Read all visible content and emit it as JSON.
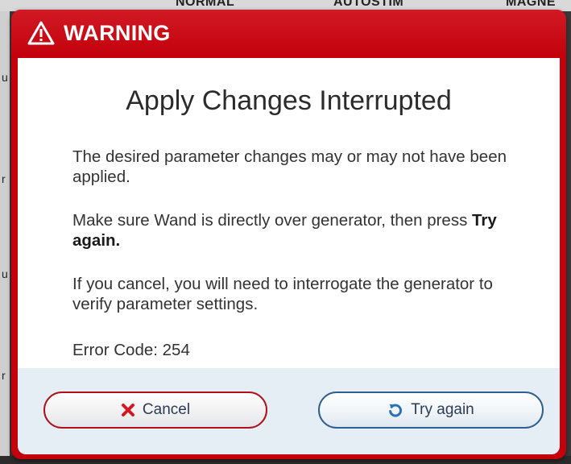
{
  "background": {
    "header_labels": [
      "NORMAL",
      "AUTOSTIM",
      "MAGNE"
    ],
    "left_strip_letters": [
      "u",
      "r",
      "u",
      "r"
    ]
  },
  "dialog": {
    "header": {
      "icon": "warning-triangle-icon",
      "title": "WARNING",
      "color": "#c4000c"
    },
    "title": "Apply Changes Interrupted",
    "paragraph1": "The desired parameter changes may or may not have been applied.",
    "paragraph2_before": "Make sure Wand is directly over generator, then press ",
    "paragraph2_bold": "Try again.",
    "paragraph3": "If you cancel, you will need to interrogate the generator to verify parameter settings.",
    "error_code": "Error Code: 254",
    "buttons": {
      "cancel": {
        "label": "Cancel",
        "icon": "x-icon",
        "icon_color": "#d11a24"
      },
      "retry": {
        "label": "Try again",
        "icon": "refresh-icon",
        "icon_color": "#2a72b8"
      }
    }
  }
}
